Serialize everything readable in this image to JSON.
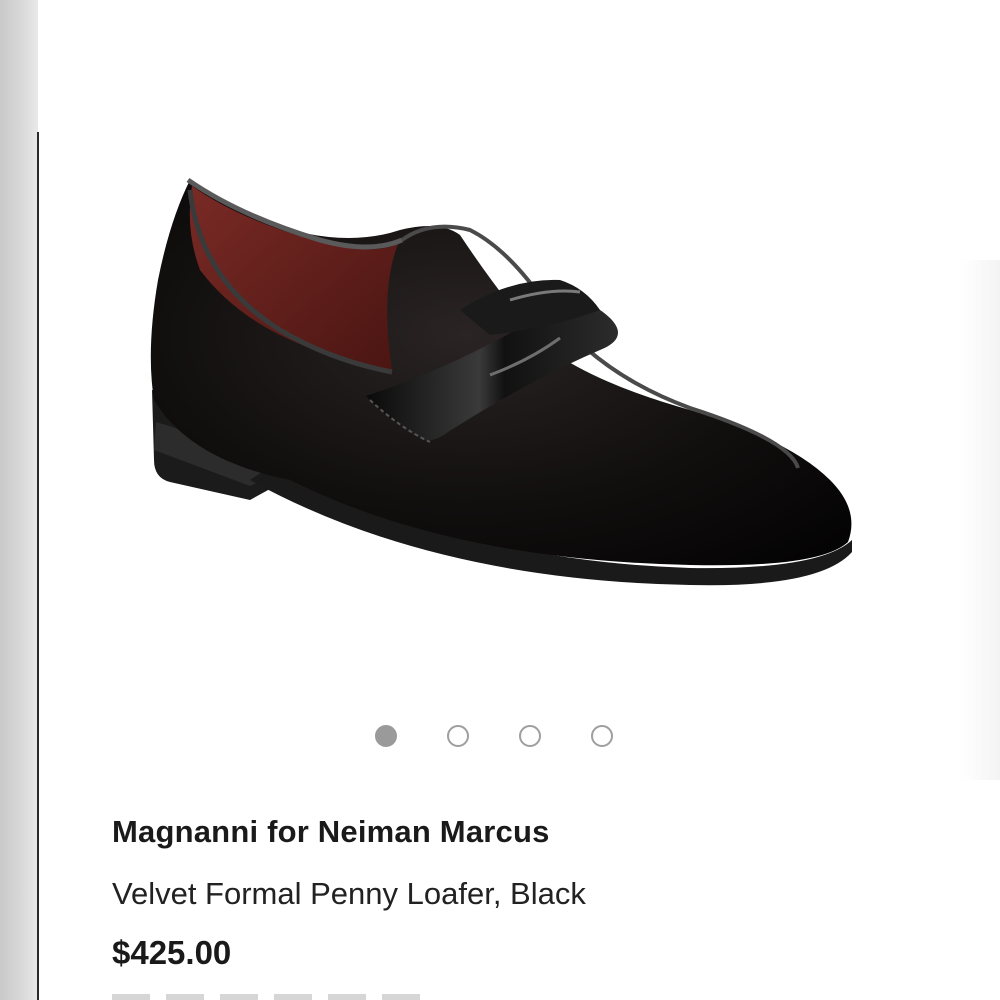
{
  "product": {
    "brand": "Magnanni for Neiman Marcus",
    "name": "Velvet Formal Penny Loafer, Black",
    "price": "$425.00",
    "image_icon": "loafer-shoe-photo"
  },
  "carousel": {
    "count": 4,
    "active_index": 0
  },
  "colors": {
    "shoe_body": "#0d0b0b",
    "lining": "#6e1f1c",
    "active_dot": "#9a9a9a",
    "inactive_dot_border": "#9e9e9e"
  }
}
